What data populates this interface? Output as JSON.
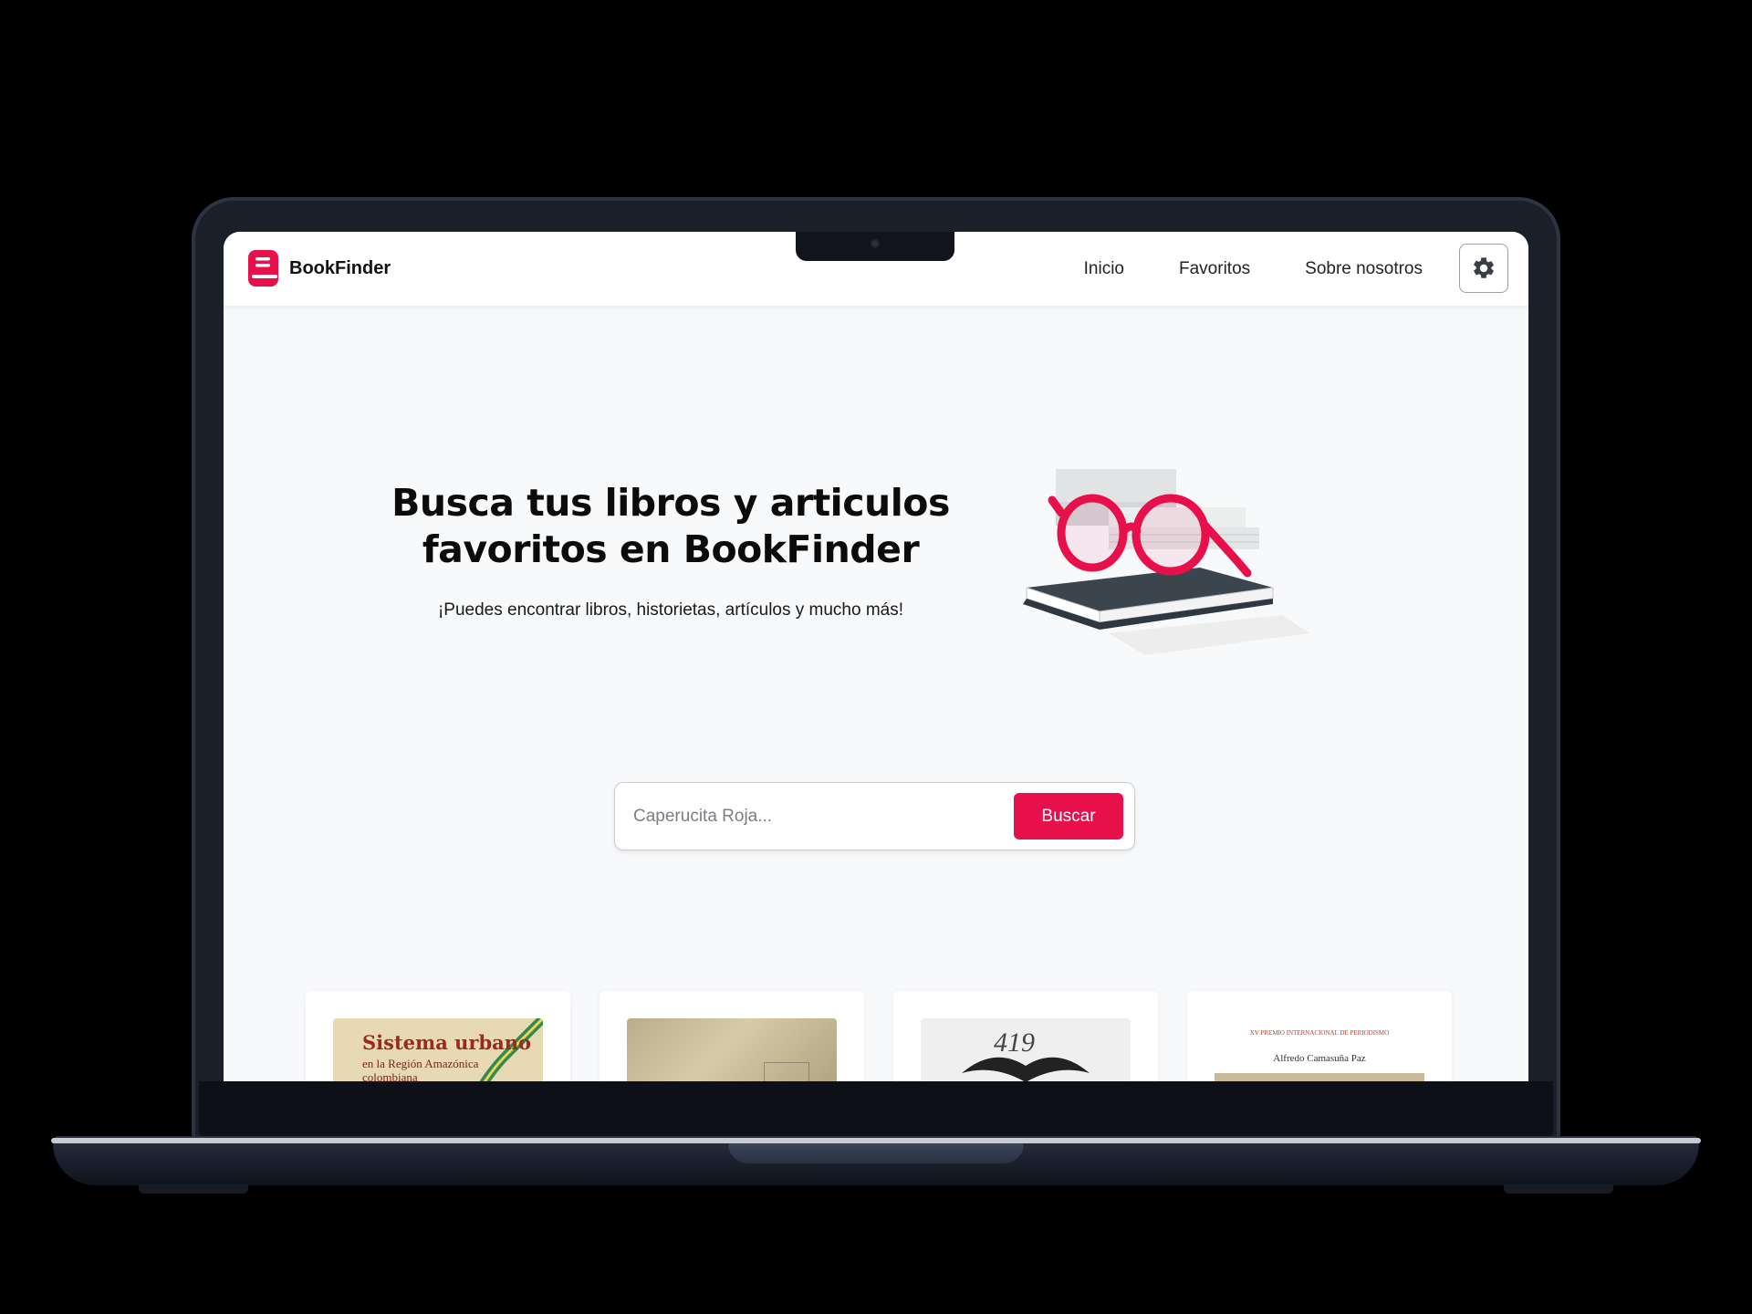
{
  "app": {
    "brand_name": "BookFinder",
    "accent_color": "#e8104a",
    "logo_icon": "book-icon"
  },
  "navbar": {
    "links": [
      {
        "label": "Inicio"
      },
      {
        "label": "Favoritos"
      },
      {
        "label": "Sobre nosotros"
      }
    ],
    "settings_icon": "gear-icon"
  },
  "hero": {
    "title": "Busca tus libros y articulos favoritos en BookFinder",
    "subtitle": "¡Puedes encontrar libros, historietas, artículos y mucho más!",
    "illustration_icon": "glasses-on-books-icon"
  },
  "search": {
    "placeholder": "Caperucita Roja...",
    "value": "",
    "button_label": "Buscar"
  },
  "books": [
    {
      "cover_title": "Sistema urbano",
      "cover_subtitle": "en la Región Amazónica colombiana"
    },
    {
      "cover_title": ""
    },
    {
      "cover_title": "419"
    },
    {
      "cover_heading": "XV PREMIO INTERNACIONAL DE PERIODISMO",
      "cover_author": "Alfredo Camasuña Paz"
    }
  ]
}
